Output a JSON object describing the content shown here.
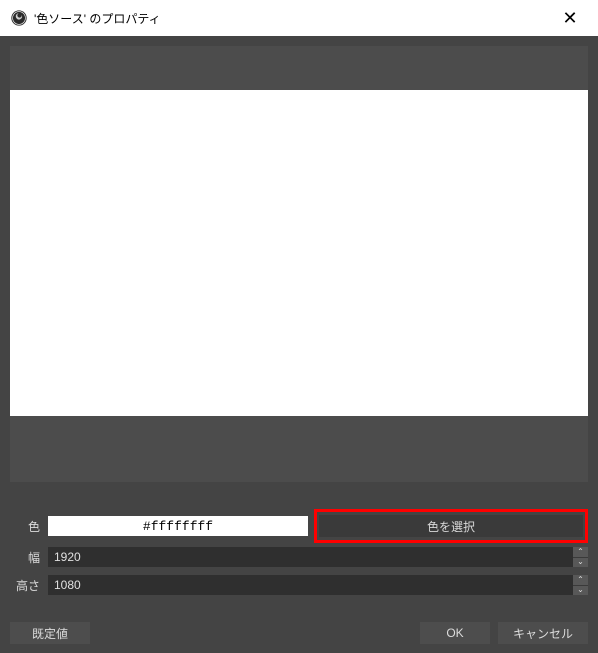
{
  "window": {
    "title": "'色ソース' のプロパティ"
  },
  "properties": {
    "color_label": "色",
    "color_value": "#ffffffff",
    "pick_color_button": "色を選択",
    "width_label": "幅",
    "width_value": "1920",
    "height_label": "高さ",
    "height_value": "1080"
  },
  "footer": {
    "defaults": "既定値",
    "ok": "OK",
    "cancel": "キャンセル"
  },
  "colors": {
    "preview_fill": "#ffffff",
    "highlight_border": "#ff0000"
  }
}
